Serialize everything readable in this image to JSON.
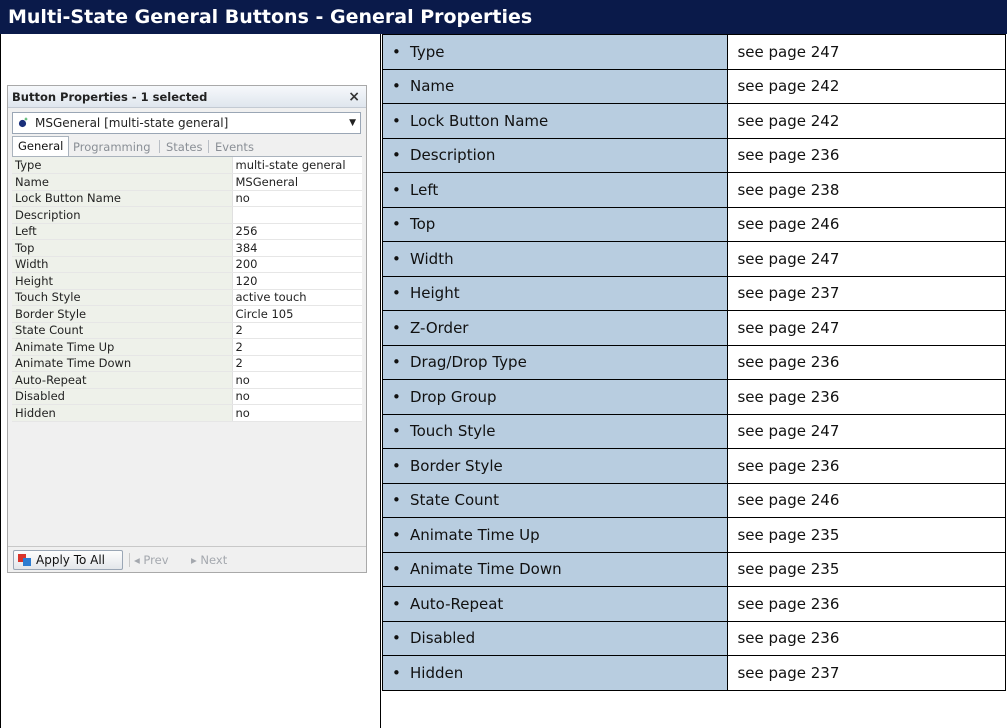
{
  "header": {
    "title": "Multi-State General Buttons - General Properties"
  },
  "panel": {
    "title": "Button Properties - 1 selected",
    "close_glyph": "×",
    "combo_value": "MSGeneral  [multi-state general]",
    "tabs": [
      "General",
      "Programming",
      "States",
      "Events"
    ],
    "active_tab": "General",
    "rows": [
      {
        "key": "Type",
        "value": "multi-state general"
      },
      {
        "key": "Name",
        "value": "MSGeneral"
      },
      {
        "key": "Lock Button Name",
        "value": "no"
      },
      {
        "key": "Description",
        "value": ""
      },
      {
        "key": "Left",
        "value": "256"
      },
      {
        "key": "Top",
        "value": "384"
      },
      {
        "key": "Width",
        "value": "200"
      },
      {
        "key": "Height",
        "value": "120"
      },
      {
        "key": "Touch Style",
        "value": "active touch"
      },
      {
        "key": "Border Style",
        "value": "Circle 105"
      },
      {
        "key": "State Count",
        "value": "2"
      },
      {
        "key": "Animate Time Up",
        "value": "2"
      },
      {
        "key": "Animate Time Down",
        "value": "2"
      },
      {
        "key": "Auto-Repeat",
        "value": "no"
      },
      {
        "key": "Disabled",
        "value": "no"
      },
      {
        "key": "Hidden",
        "value": "no"
      }
    ],
    "apply_label": "Apply To All",
    "prev_label": "◂ Prev",
    "next_label": "▸ Next"
  },
  "properties": [
    {
      "name": "Type",
      "page": "see page 247"
    },
    {
      "name": "Name",
      "page": "see page 242"
    },
    {
      "name": "Lock Button Name",
      "page": "see page 242"
    },
    {
      "name": "Description",
      "page": "see page 236"
    },
    {
      "name": "Left",
      "page": "see page 238"
    },
    {
      "name": "Top",
      "page": "see page 246"
    },
    {
      "name": "Width",
      "page": "see page 247"
    },
    {
      "name": "Height",
      "page": "see page 237"
    },
    {
      "name": "Z-Order",
      "page": "see page 247"
    },
    {
      "name": "Drag/Drop Type",
      "page": "see page 236"
    },
    {
      "name": "Drop Group",
      "page": "see page 236"
    },
    {
      "name": "Touch Style",
      "page": "see page 247"
    },
    {
      "name": "Border Style",
      "page": "see page 236"
    },
    {
      "name": "State Count",
      "page": "see page 246"
    },
    {
      "name": "Animate Time Up",
      "page": "see page 235"
    },
    {
      "name": "Animate Time Down",
      "page": "see page 235"
    },
    {
      "name": "Auto-Repeat",
      "page": "see page 236"
    },
    {
      "name": "Disabled",
      "page": "see page 236"
    },
    {
      "name": "Hidden",
      "page": "see page 237"
    }
  ],
  "colors": {
    "header_bg": "#0a1a4a",
    "name_cell_bg": "#b8cde0"
  }
}
